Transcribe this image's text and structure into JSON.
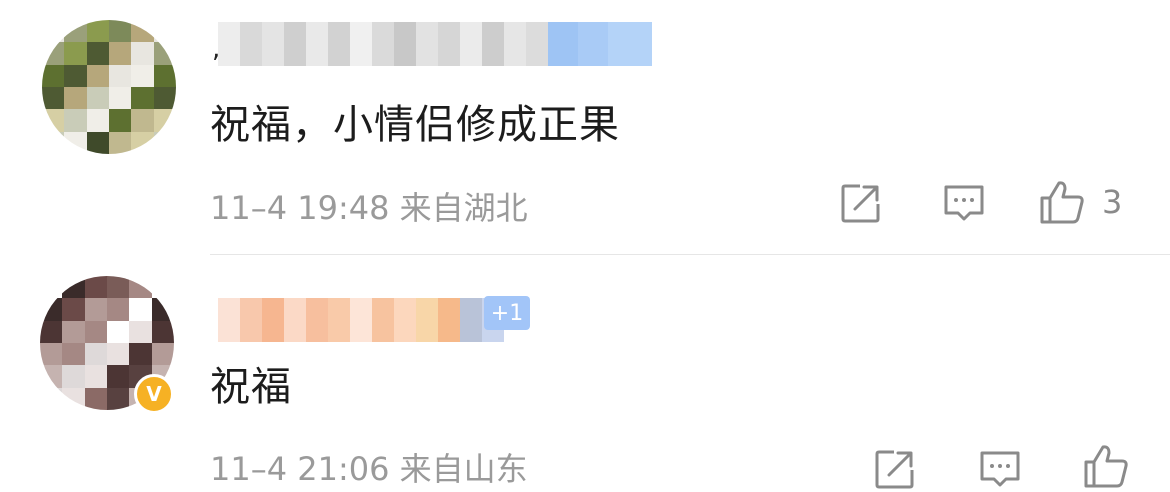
{
  "comments": [
    {
      "username_comma": ",",
      "text": "祝福，小情侣修成正果",
      "meta": "11–4 19:48 来自湖北",
      "likes": "3"
    },
    {
      "text": "祝福",
      "fan_badge": "+1",
      "verified_badge": "V",
      "meta": "11–4 21:06 来自山东"
    }
  ],
  "icons": {
    "share": "share-icon",
    "reply": "comment-icon",
    "like": "thumbs-up-icon",
    "verify": "verified-badge-icon"
  },
  "colors": {
    "text": "#1c1c1c",
    "meta": "#9a9a9a",
    "verified": "#f6b124",
    "fan_badge": "#a2c5f8",
    "divider": "#e6e6e6"
  }
}
